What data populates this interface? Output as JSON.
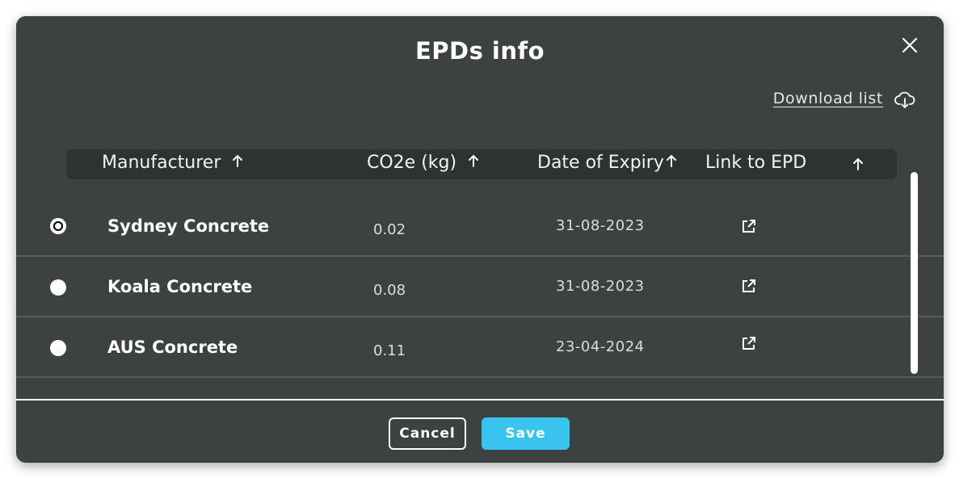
{
  "modal": {
    "title": "EPDs info",
    "download_label": "Download list"
  },
  "table": {
    "columns": [
      {
        "label": "Manufacturer",
        "sort_icon": "arrow-up-icon"
      },
      {
        "label": "CO2e (kg)",
        "sort_icon": "arrow-up-icon"
      },
      {
        "label": "Date of Expiry",
        "sort_icon": "arrow-up-icon"
      },
      {
        "label": "Link to EPD",
        "sort_icon": "arrow-up-icon"
      }
    ],
    "rows": [
      {
        "manufacturer": "Sydney Concrete",
        "co2e": "0.02",
        "expiry": "31-08-2023",
        "selected": true
      },
      {
        "manufacturer": "Koala Concrete",
        "co2e": "0.08",
        "expiry": "31-08-2023",
        "selected": false
      },
      {
        "manufacturer": "AUS Concrete",
        "co2e": "0.11",
        "expiry": "23-04-2024",
        "selected": false
      }
    ]
  },
  "footer": {
    "cancel_label": "Cancel",
    "save_label": "Save"
  },
  "colors": {
    "modal_bg": "#3d4141",
    "header_bg": "#2f3232",
    "accent": "#39c4ef"
  }
}
